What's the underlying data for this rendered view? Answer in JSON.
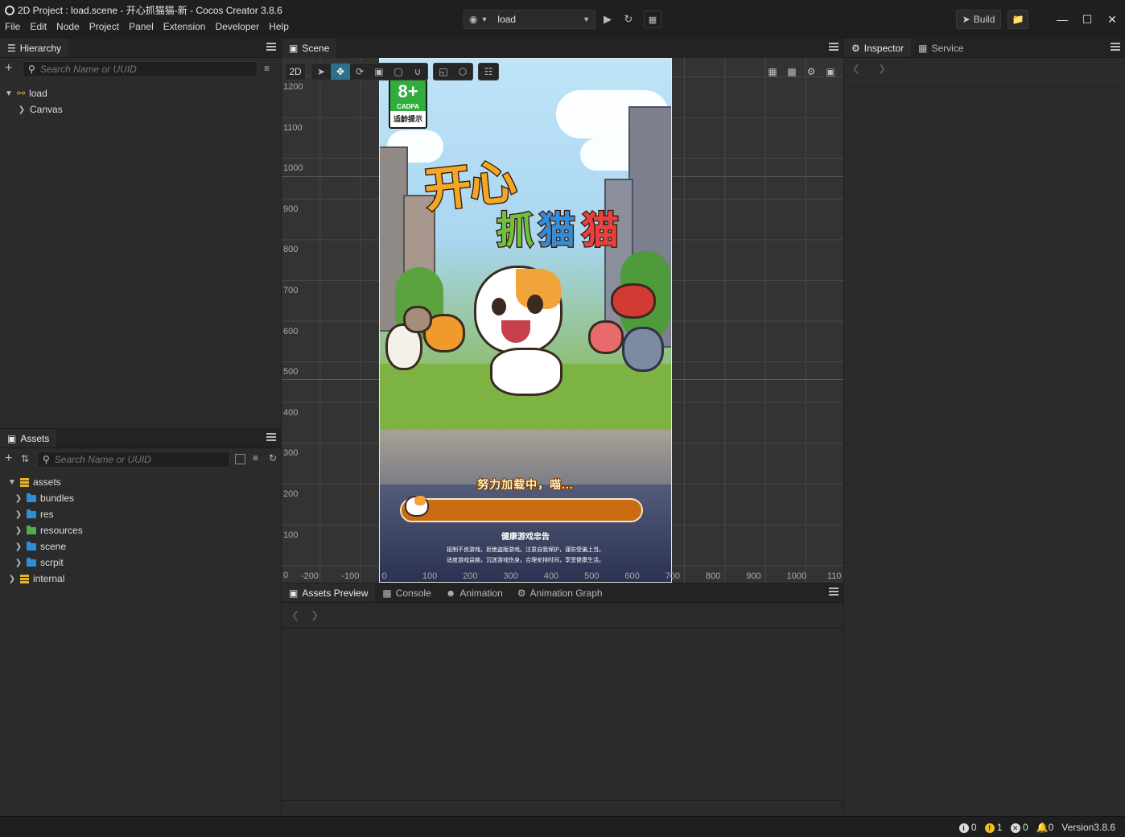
{
  "window": {
    "title": "2D Project : load.scene - 开心抓猫猫-新 - Cocos Creator 3.8.6",
    "menu": [
      "File",
      "Edit",
      "Node",
      "Project",
      "Panel",
      "Extension",
      "Developer",
      "Help"
    ]
  },
  "toolbar": {
    "scene_value": "load",
    "build_label": "Build"
  },
  "hierarchy": {
    "tab": "Hierarchy",
    "search_placeholder": "Search Name or UUID",
    "root": "load",
    "child": "Canvas"
  },
  "assets": {
    "tab": "Assets",
    "search_placeholder": "Search Name or UUID",
    "items": [
      {
        "label": "assets",
        "type": "db",
        "level": 0,
        "expanded": true
      },
      {
        "label": "bundles",
        "type": "folder",
        "level": 1
      },
      {
        "label": "res",
        "type": "folder",
        "level": 1
      },
      {
        "label": "resources",
        "type": "folder-green",
        "level": 1
      },
      {
        "label": "scene",
        "type": "folder",
        "level": 1
      },
      {
        "label": "scrpit",
        "type": "folder",
        "level": 1
      },
      {
        "label": "internal",
        "type": "db",
        "level": 0
      }
    ]
  },
  "scene": {
    "tab": "Scene",
    "mode_label": "2D",
    "y_ticks": [
      "1200",
      "1100",
      "1000",
      "900",
      "800",
      "700",
      "600",
      "500",
      "400",
      "300",
      "200",
      "100",
      "0"
    ],
    "x_ticks": [
      "-200",
      "-100",
      "0",
      "100",
      "200",
      "300",
      "400",
      "500",
      "600",
      "700",
      "800",
      "900",
      "1000",
      "110"
    ]
  },
  "game": {
    "age_rating": "8+",
    "age_org": "CADPA",
    "age_hint": "适龄提示",
    "logo_line1": "开心",
    "logo_line2": [
      "抓",
      "猫",
      "猫"
    ],
    "loading_text": "努力加载中，喵...",
    "progress": 0.0,
    "notice_title": "健康游戏忠告",
    "notice_lines": [
      "抵制不良游戏，拒绝盗版游戏。注意自我保护，谨防受骗上当。",
      "适度游戏益脑，沉迷游戏伤身。合理安排时间，享受健康生活。"
    ]
  },
  "inspector": {
    "tabs": [
      "Inspector",
      "Service"
    ]
  },
  "bottom": {
    "tabs": [
      "Assets Preview",
      "Console",
      "Animation",
      "Animation Graph"
    ]
  },
  "status": {
    "info_count": "0",
    "warn_count": "1",
    "error_count": "0",
    "notif_count": "0",
    "version": "Version3.8.6"
  },
  "colors": {
    "accent": "#2e6f8c",
    "progress_track": "#c86d12",
    "warn": "#f0c020"
  }
}
